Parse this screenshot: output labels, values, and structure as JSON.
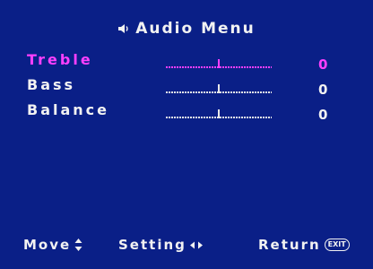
{
  "menu": {
    "title": "Audio Menu",
    "title_icon": "speaker-icon",
    "accent_color": "#ff3fff",
    "background_color": "#0a1f87",
    "items": [
      {
        "label": "Treble",
        "value": "0",
        "level": 0.5,
        "selected": true
      },
      {
        "label": "Bass",
        "value": "0",
        "level": 0.5,
        "selected": false
      },
      {
        "label": "Balance",
        "value": "0",
        "level": 0.5,
        "selected": false
      }
    ]
  },
  "footer": {
    "move_label": "Move",
    "move_icon": "up-down-arrows-icon",
    "setting_label": "Setting",
    "setting_icon": "left-right-arrows-icon",
    "return_label": "Return",
    "exit_badge": "EXIT"
  }
}
